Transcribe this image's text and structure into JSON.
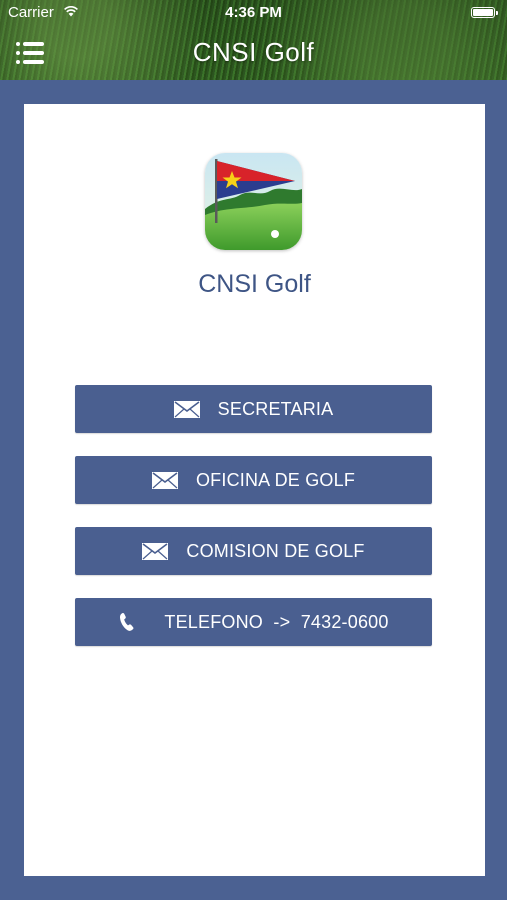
{
  "status_bar": {
    "carrier": "Carrier",
    "time": "4:36 PM"
  },
  "nav": {
    "title": "CNSI Golf",
    "menu_icon": "menu-icon"
  },
  "app": {
    "name": "CNSI Golf",
    "logo_icon": "golf-flag-logo"
  },
  "buttons": [
    {
      "label": "SECRETARIA",
      "icon": "envelope-icon"
    },
    {
      "label": "OFICINA DE GOLF",
      "icon": "envelope-icon"
    },
    {
      "label": "COMISION DE GOLF",
      "icon": "envelope-icon"
    },
    {
      "label": "TELEFONO  ->  7432-0600",
      "icon": "phone-icon"
    }
  ],
  "colors": {
    "primary": "#4a5f90",
    "background": "#4b6192",
    "title_text": "#3e5585"
  }
}
